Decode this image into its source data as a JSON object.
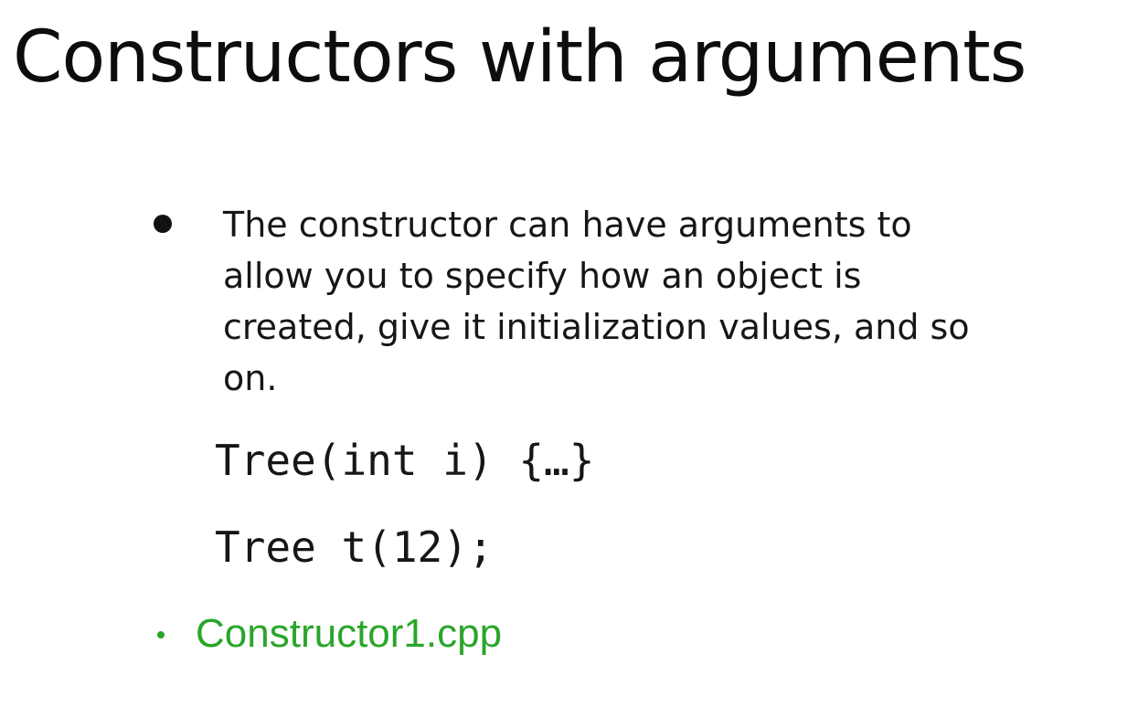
{
  "slide": {
    "title": "Constructors with arguments",
    "bullet_text": "The constructor can have arguments to allow you to specify how an object is created, give it initialization values, and so on.",
    "code_lines": [
      "Tree(int i) {…}",
      "Tree t(12);"
    ],
    "file_link": "Constructor1.cpp"
  },
  "colors": {
    "text": "#111111",
    "link": "#2aa52a",
    "background": "#ffffff"
  }
}
